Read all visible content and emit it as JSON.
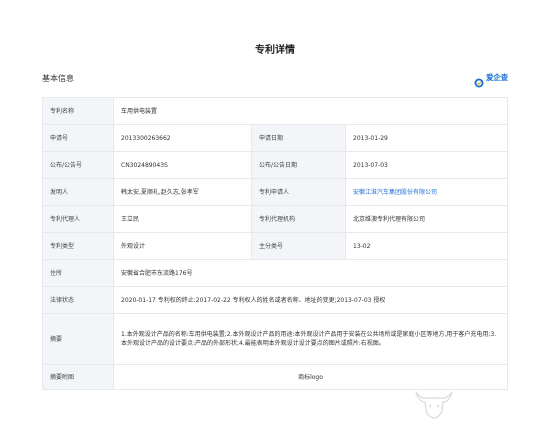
{
  "header": {
    "title": "专利详情"
  },
  "section": {
    "title": "基本信息"
  },
  "brand": {
    "text": "爱企查",
    "icon": "qichacha-logo-icon"
  },
  "table": {
    "patent_name_label": "专利名称",
    "patent_name_value": "车用供电装置",
    "app_no_label": "申请号",
    "app_no_value": "2013300263662",
    "app_date_label": "申请日期",
    "app_date_value": "2013-01-29",
    "pub_no_label": "公布/公告号",
    "pub_no_value": "CN302489043S",
    "pub_date_label": "公布/公告日期",
    "pub_date_value": "2013-07-03",
    "inventor_label": "发明人",
    "inventor_value": "韩太安,夏顺礼,赵久志,张孝军",
    "applicant_label": "专利申请人",
    "applicant_value": "安徽江淮汽车集团股份有限公司",
    "agent_label": "专利代理人",
    "agent_value": "王立民",
    "agency_label": "专利代理机构",
    "agency_value": "北京维澳专利代理有限公司",
    "type_label": "专利类型",
    "type_value": "外观设计",
    "class_label": "主分类号",
    "class_value": "13-02",
    "address_label": "住所",
    "address_value": "安徽省合肥市东流路176号",
    "legal_label": "法律状态",
    "legal_value": "2020-01-17 专利权的终止:2017-02-22 专利权人的姓名或者名称、地址的变更;2013-07-03 授权",
    "abstract_label": "摘要",
    "abstract_value": "1.本外观设计产品的名称:车用供电装置;2.本外观设计产品的用途:本外观设计产品用于安装在公共场所或是家庭小区等地方,用于客户充电用;3.本外观设计产品的设计要点:产品的外部形状;4.最能表明本外观设计设计要点的图片或照片:右视图。",
    "abstract_image_label": "摘要附图",
    "abstract_image_value": "商标logo"
  },
  "colors": {
    "accent": "#2a6fd6",
    "label_bg": "#f3f5f8",
    "border": "#e6e9ee"
  }
}
